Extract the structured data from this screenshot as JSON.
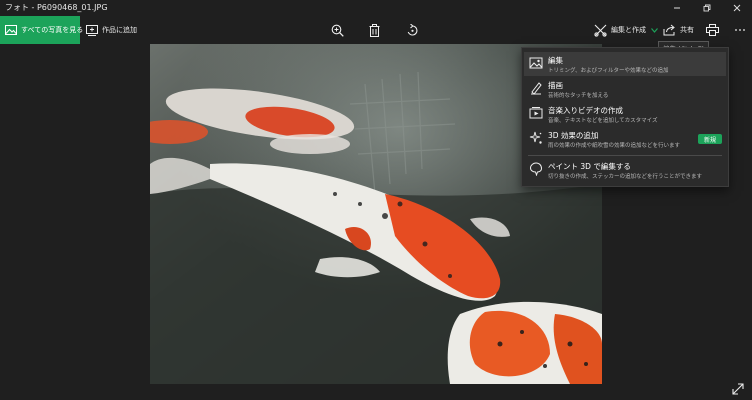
{
  "window": {
    "title": "フォト - P6090468_01.JPG"
  },
  "toolbar": {
    "all_photos_label": "すべての写真を見る",
    "add_to_creation_label": "作品に追加",
    "edit_create_label": "編集と作成",
    "share_label": "共有"
  },
  "tooltip": {
    "text": "編集 (Ctrl+E)"
  },
  "menu": {
    "items": [
      {
        "title": "編集",
        "subtitle": "トリミング、およびフィルターや効果などの追加",
        "icon": "edit-photo-icon"
      },
      {
        "title": "描画",
        "subtitle": "芸術的なタッチを加える",
        "icon": "pen-icon"
      },
      {
        "title": "音楽入りビデオの作成",
        "subtitle": "音楽、テキストなどを追加してカスタマイズ",
        "icon": "video-icon"
      },
      {
        "title": "3D 効果の追加",
        "subtitle": "雨の効果の作成や紙吹雪の効果の追加などを行います",
        "icon": "sparkle-icon",
        "badge": "新規"
      },
      {
        "title": "ペイント 3D で編集する",
        "subtitle": "切り抜きの作成、ステッカーの追加などを行うことができます",
        "icon": "paint3d-icon"
      }
    ]
  },
  "colors": {
    "accent": "#1ca35a",
    "background": "#1f1f1f",
    "menu_background": "#2b2b2b"
  }
}
